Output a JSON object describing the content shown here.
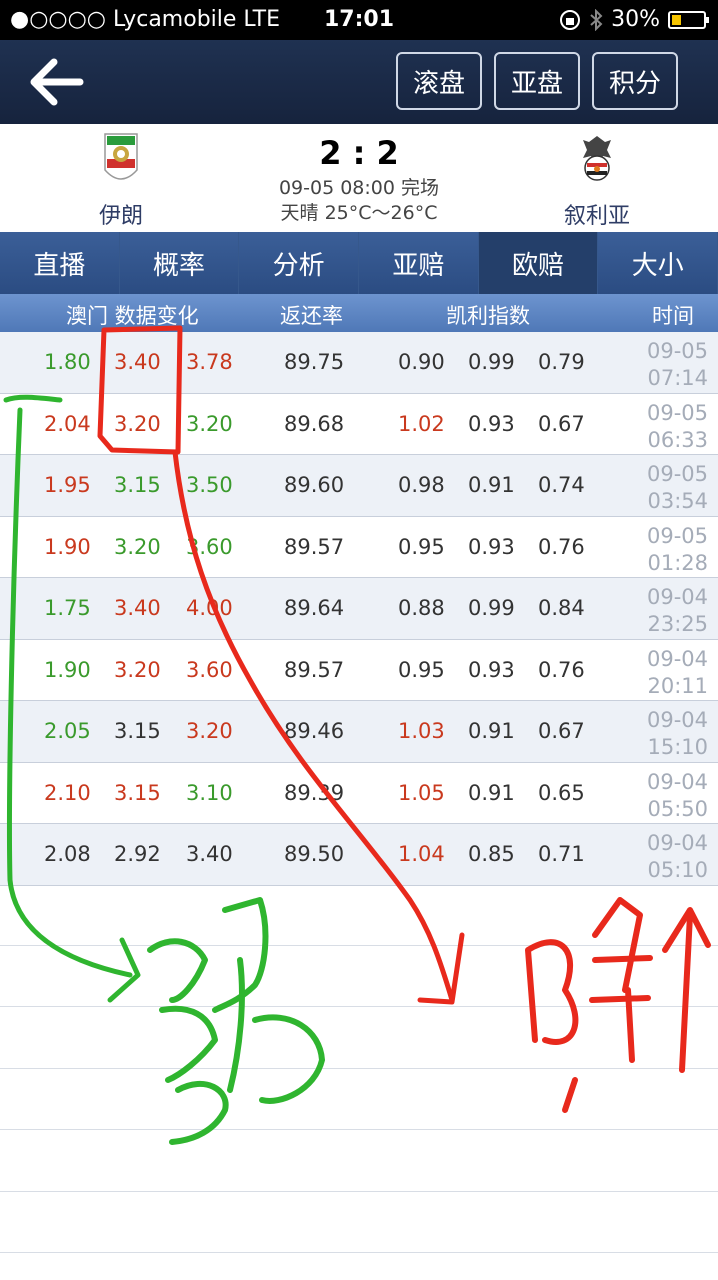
{
  "status_bar": {
    "carrier": "●○○○○ Lycamobile  LTE",
    "time": "17:01",
    "battery": "30%",
    "battery_level": 0.3
  },
  "nav": {
    "back_icon": "arrow-left-icon",
    "buttons": [
      "滚盘",
      "亚盘",
      "积分"
    ]
  },
  "match": {
    "home_team": "伊朗",
    "away_team": "叙利亚",
    "score": "2 : 2",
    "datetime_status": "09-05 08:00 完场",
    "weather": "天晴 25°C～26°C"
  },
  "tabs": [
    "直播",
    "概率",
    "分析",
    "亚赔",
    "欧赔",
    "大小"
  ],
  "active_tab_index": 4,
  "columns": {
    "odds_change": "澳门 数据变化",
    "return_rate": "返还率",
    "kelly": "凯利指数",
    "time": "时间"
  },
  "rows": [
    {
      "o1": "1.80",
      "o2": "3.40",
      "o3": "3.78",
      "rr": "89.75",
      "k1": "0.90",
      "k2": "0.99",
      "k3": "0.79",
      "date": "09-05",
      "time": "07:14",
      "c": [
        "green",
        "red",
        "red",
        "dark",
        "dark",
        "dark"
      ]
    },
    {
      "o1": "2.04",
      "o2": "3.20",
      "o3": "3.20",
      "rr": "89.68",
      "k1": "1.02",
      "k2": "0.93",
      "k3": "0.67",
      "date": "09-05",
      "time": "06:33",
      "c": [
        "red",
        "red",
        "green",
        "red",
        "dark",
        "dark"
      ]
    },
    {
      "o1": "1.95",
      "o2": "3.15",
      "o3": "3.50",
      "rr": "89.60",
      "k1": "0.98",
      "k2": "0.91",
      "k3": "0.74",
      "date": "09-05",
      "time": "03:54",
      "c": [
        "red",
        "green",
        "green",
        "dark",
        "dark",
        "dark"
      ]
    },
    {
      "o1": "1.90",
      "o2": "3.20",
      "o3": "3.60",
      "rr": "89.57",
      "k1": "0.95",
      "k2": "0.93",
      "k3": "0.76",
      "date": "09-05",
      "time": "01:28",
      "c": [
        "red",
        "green",
        "green",
        "dark",
        "dark",
        "dark"
      ]
    },
    {
      "o1": "1.75",
      "o2": "3.40",
      "o3": "4.00",
      "rr": "89.64",
      "k1": "0.88",
      "k2": "0.99",
      "k3": "0.84",
      "date": "09-04",
      "time": "23:25",
      "c": [
        "green",
        "red",
        "red",
        "dark",
        "dark",
        "dark"
      ]
    },
    {
      "o1": "1.90",
      "o2": "3.20",
      "o3": "3.60",
      "rr": "89.57",
      "k1": "0.95",
      "k2": "0.93",
      "k3": "0.76",
      "date": "09-04",
      "time": "20:11",
      "c": [
        "green",
        "red",
        "red",
        "dark",
        "dark",
        "dark"
      ]
    },
    {
      "o1": "2.05",
      "o2": "3.15",
      "o3": "3.20",
      "rr": "89.46",
      "k1": "1.03",
      "k2": "0.91",
      "k3": "0.67",
      "date": "09-04",
      "time": "15:10",
      "c": [
        "green",
        "dark",
        "red",
        "red",
        "dark",
        "dark"
      ]
    },
    {
      "o1": "2.10",
      "o2": "3.15",
      "o3": "3.10",
      "rr": "89.39",
      "k1": "1.05",
      "k2": "0.91",
      "k3": "0.65",
      "date": "09-04",
      "time": "05:50",
      "c": [
        "red",
        "red",
        "green",
        "red",
        "dark",
        "dark"
      ]
    },
    {
      "o1": "2.08",
      "o2": "2.92",
      "o3": "3.40",
      "rr": "89.50",
      "k1": "1.04",
      "k2": "0.85",
      "k3": "0.71",
      "date": "09-04",
      "time": "05:10",
      "c": [
        "dark",
        "dark",
        "dark",
        "red",
        "dark",
        "dark"
      ]
    }
  ],
  "colors": {
    "green": "#3a9a2c",
    "red": "#c9391e",
    "annotation_green": "#2fb52f",
    "annotation_red": "#e8291c"
  }
}
